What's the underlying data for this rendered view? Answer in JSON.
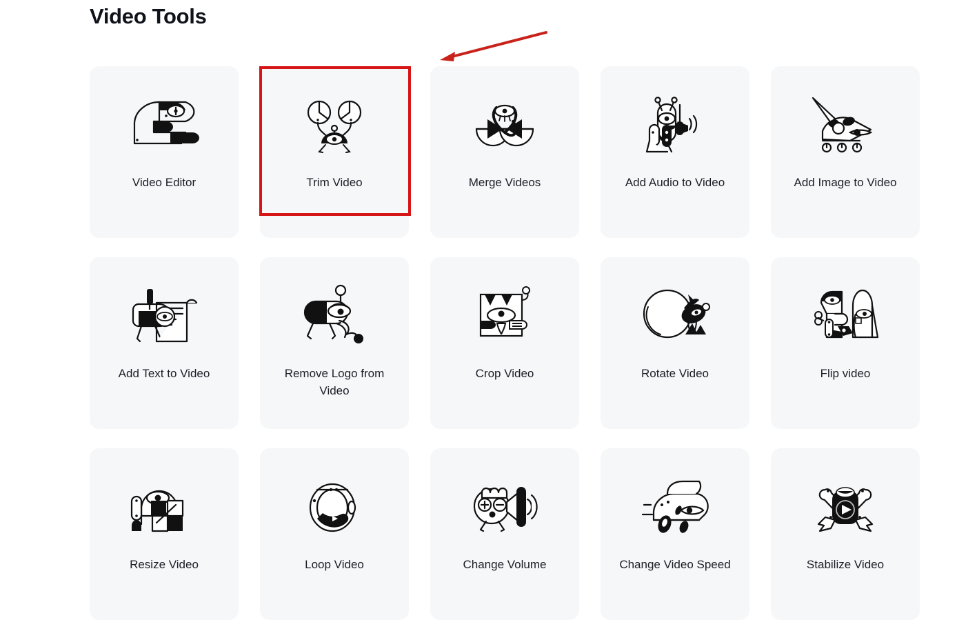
{
  "page": {
    "title": "Video Tools",
    "background_color": "#ffffff",
    "card_background_color": "#f6f7f9",
    "label_color": "#1c1e26",
    "accent_color": "#d61616"
  },
  "annotations": {
    "highlight": {
      "target_label": "Trim Video",
      "color": "#d61616",
      "shape": "rectangle"
    },
    "arrow": {
      "color": "#c9221b",
      "points_to": "Trim Video",
      "direction": "down-left"
    }
  },
  "tools": [
    {
      "label": "Video Editor",
      "icon": "video-editor-icon"
    },
    {
      "label": "Trim Video",
      "icon": "trim-video-icon"
    },
    {
      "label": "Merge Videos",
      "icon": "merge-videos-icon"
    },
    {
      "label": "Add Audio to Video",
      "icon": "add-audio-icon"
    },
    {
      "label": "Add Image to Video",
      "icon": "add-image-icon"
    },
    {
      "label": "Add Text to Video",
      "icon": "add-text-icon"
    },
    {
      "label": "Remove Logo from Video",
      "icon": "remove-logo-icon"
    },
    {
      "label": "Crop Video",
      "icon": "crop-video-icon"
    },
    {
      "label": "Rotate Video",
      "icon": "rotate-video-icon"
    },
    {
      "label": "Flip video",
      "icon": "flip-video-icon"
    },
    {
      "label": "Resize Video",
      "icon": "resize-video-icon"
    },
    {
      "label": "Loop Video",
      "icon": "loop-video-icon"
    },
    {
      "label": "Change Volume",
      "icon": "change-volume-icon"
    },
    {
      "label": "Change Video Speed",
      "icon": "change-speed-icon"
    },
    {
      "label": "Stabilize Video",
      "icon": "stabilize-video-icon"
    }
  ]
}
